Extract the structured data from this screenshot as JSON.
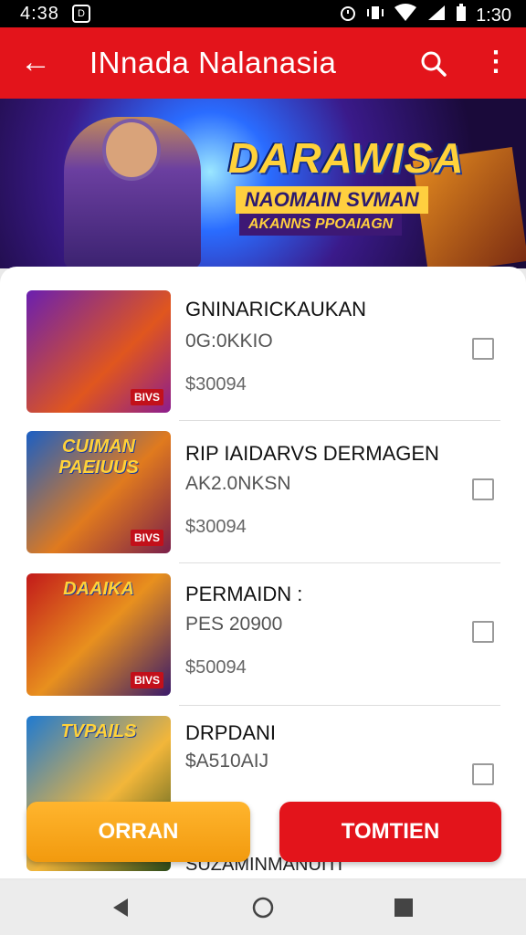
{
  "status_bar": {
    "time": "4:38",
    "clock_right": "1:30",
    "notification_glyph": "D"
  },
  "app_bar": {
    "title": "INnada Nalanasia",
    "back_icon": "←",
    "more_icon": "⋮"
  },
  "banner": {
    "title": "DARAWISA",
    "subtitle_1": "NAOMAIN SVMAN",
    "subtitle_2": "AKANNS PPOAIAGN"
  },
  "items": [
    {
      "name": "GNINARICKAUKAN",
      "sub": "0G:0KKIO",
      "price": "$30094",
      "thumb_label": "",
      "badge": "BIVS"
    },
    {
      "name": "RIP IAIDARVS DERMAGEN",
      "sub": "AK2.0NKSN",
      "price": "$30094",
      "thumb_label": "CUIMAN PAEIUUS",
      "badge": "BIVS"
    },
    {
      "name": "PERMAIDN :",
      "sub": "PES 20900",
      "price": "$50094",
      "thumb_label": "DAAIKA",
      "badge": "BIVS"
    },
    {
      "name": "DRPDANI",
      "sub": "$A510AIJ",
      "price": "",
      "thumb_label": "TVPAILS",
      "badge": ""
    }
  ],
  "footer_peek": "SUZAMINMANUITI",
  "buttons": {
    "primary": "ORRAN",
    "secondary": "TOMTIEN"
  },
  "colors": {
    "brand_red": "#e3141b",
    "accent_orange": "#f7a51c"
  }
}
